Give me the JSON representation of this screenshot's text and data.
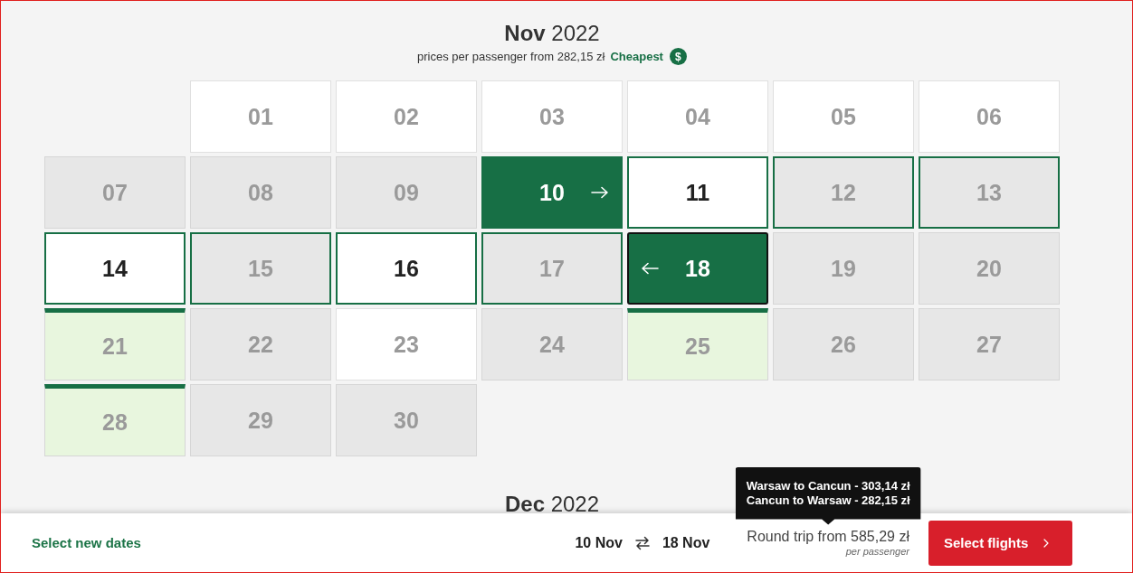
{
  "calendar": {
    "months": [
      {
        "title": "**Nov** 2022",
        "subtitle": "prices per passenger from 282,15 zł",
        "cheapest_label": "Cheapest",
        "cheapest_symbol": "$",
        "days": [
          {
            "kind": "blank"
          },
          {
            "kind": "day",
            "label": "01",
            "available": true,
            "in_range": false,
            "selected": false,
            "cheapest": false
          },
          {
            "kind": "day",
            "label": "02",
            "available": true,
            "in_range": false,
            "selected": false,
            "cheapest": false
          },
          {
            "kind": "day",
            "label": "03",
            "available": true,
            "in_range": false,
            "selected": false,
            "cheapest": false
          },
          {
            "kind": "day",
            "label": "04",
            "available": true,
            "in_range": false,
            "selected": false,
            "cheapest": false
          },
          {
            "kind": "day",
            "label": "05",
            "available": true,
            "in_range": false,
            "selected": false,
            "cheapest": false
          },
          {
            "kind": "day",
            "label": "06",
            "available": true,
            "in_range": false,
            "selected": false,
            "cheapest": false
          },
          {
            "kind": "day",
            "label": "07",
            "available": false,
            "in_range": false,
            "selected": false,
            "cheapest": false
          },
          {
            "kind": "day",
            "label": "08",
            "available": false,
            "in_range": false,
            "selected": false,
            "cheapest": false
          },
          {
            "kind": "day",
            "label": "09",
            "available": false,
            "in_range": false,
            "selected": false,
            "cheapest": false
          },
          {
            "kind": "outbound",
            "label": "10",
            "available": true,
            "in_range": false,
            "selected": true,
            "cheapest": false
          },
          {
            "kind": "day",
            "label": "11",
            "available": true,
            "in_range": true,
            "selected": false,
            "cheapest": false
          },
          {
            "kind": "day",
            "label": "12",
            "available": false,
            "in_range": true,
            "selected": false,
            "cheapest": false
          },
          {
            "kind": "day",
            "label": "13",
            "available": false,
            "in_range": true,
            "selected": false,
            "cheapest": false
          },
          {
            "kind": "day",
            "label": "14",
            "available": true,
            "in_range": true,
            "selected": false,
            "cheapest": false
          },
          {
            "kind": "day",
            "label": "15",
            "available": false,
            "in_range": true,
            "selected": false,
            "cheapest": false
          },
          {
            "kind": "day",
            "label": "16",
            "available": true,
            "in_range": true,
            "selected": false,
            "cheapest": false
          },
          {
            "kind": "day",
            "label": "17",
            "available": false,
            "in_range": true,
            "selected": false,
            "cheapest": false
          },
          {
            "kind": "return",
            "label": "18",
            "available": true,
            "in_range": false,
            "selected": true,
            "cheapest": false
          },
          {
            "kind": "day",
            "label": "19",
            "available": false,
            "in_range": false,
            "selected": false,
            "cheapest": false
          },
          {
            "kind": "day",
            "label": "20",
            "available": false,
            "in_range": false,
            "selected": false,
            "cheapest": false
          },
          {
            "kind": "day",
            "label": "21",
            "available": false,
            "in_range": false,
            "selected": false,
            "cheapest": true
          },
          {
            "kind": "day",
            "label": "22",
            "available": false,
            "in_range": false,
            "selected": false,
            "cheapest": false
          },
          {
            "kind": "day",
            "label": "23",
            "available": true,
            "in_range": false,
            "selected": false,
            "cheapest": false
          },
          {
            "kind": "day",
            "label": "24",
            "available": false,
            "in_range": false,
            "selected": false,
            "cheapest": false
          },
          {
            "kind": "day",
            "label": "25",
            "available": false,
            "in_range": false,
            "selected": false,
            "cheapest": true
          },
          {
            "kind": "day",
            "label": "26",
            "available": false,
            "in_range": false,
            "selected": false,
            "cheapest": false
          },
          {
            "kind": "day",
            "label": "27",
            "available": false,
            "in_range": false,
            "selected": false,
            "cheapest": false
          },
          {
            "kind": "day",
            "label": "28",
            "available": false,
            "in_range": false,
            "selected": false,
            "cheapest": true
          },
          {
            "kind": "day",
            "label": "29",
            "available": false,
            "in_range": false,
            "selected": false,
            "cheapest": false
          },
          {
            "kind": "day",
            "label": "30",
            "available": false,
            "in_range": false,
            "selected": false,
            "cheapest": false
          }
        ]
      },
      {
        "title": "**Dec** 2022"
      }
    ]
  },
  "footer": {
    "link": "Select new dates",
    "outbound_date": "10 Nov",
    "return_date": "18 Nov",
    "price": "Round trip from 585,29 zł",
    "price_note": "per passenger",
    "price_tooltip": [
      "Warsaw to Cancun - 303,14 zł",
      "Cancun to Warsaw - 282,15 zł"
    ],
    "button": "Select flights"
  }
}
